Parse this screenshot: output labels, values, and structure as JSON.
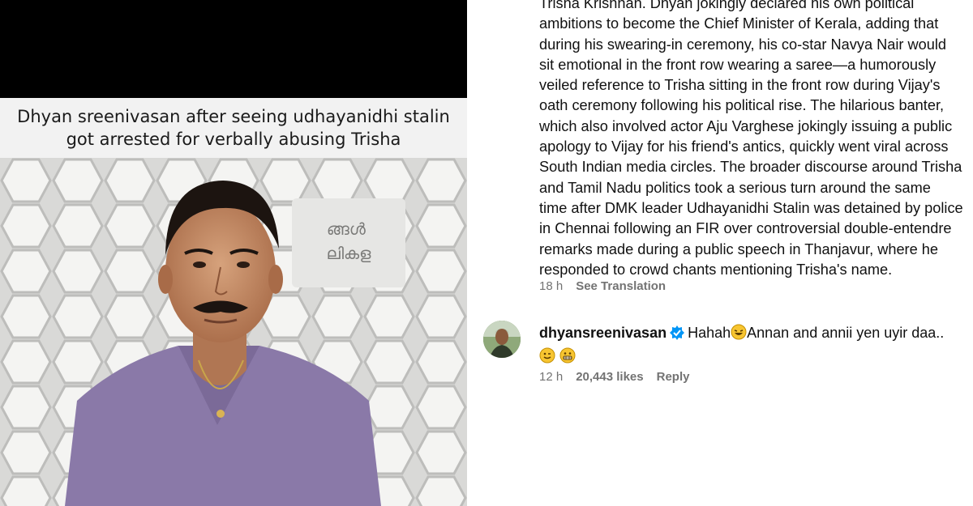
{
  "meme": {
    "caption": "Dhyan sreenivasan after seeing udhayanidhi stalin\ngot arrested for verbally abusing Trisha",
    "background_sign_text": "ങ്ങൾ\nലികള"
  },
  "post": {
    "caption": "Trisha Krishnan. Dhyan jokingly declared his own political\nambitions to become the Chief Minister of Kerala, adding that\nduring his swearing-in ceremony, his co-star Navya Nair would\nsit emotional in the front row wearing a saree—a humorously\nveiled reference to Trisha sitting in the front row during Vijay's\noath ceremony following his political rise. The hilarious banter,\nwhich also involved actor Aju Varghese jokingly issuing a public\napology to Vijay for his friend's antics, quickly went viral across\nSouth Indian media circles. The broader discourse around Trisha\nand Tamil Nadu politics took a serious turn around the same\ntime after DMK leader Udhayanidhi Stalin was detained by police\nin Chennai following an FIR over controversial double-entendre\nremarks made during a public speech in Thanjavur, where he\nresponded to crowd chants mentioning Trisha's name.",
    "time": "18 h",
    "see_translation": "See Translation"
  },
  "comment": {
    "username": "dhyansreenivasan",
    "text_part1": "Hahah",
    "text_part2": "Annan and annii yen uyir daa..",
    "time": "12 h",
    "likes": "20,443 likes",
    "reply": "Reply"
  },
  "colors": {
    "verified": "#0095f6",
    "meta_text": "#737373",
    "shirt": "#8a79a8"
  }
}
